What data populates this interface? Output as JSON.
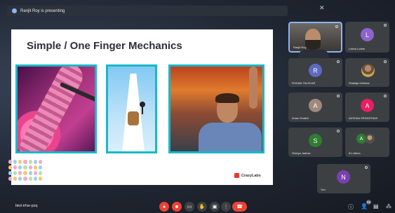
{
  "banner": {
    "text": "Ranjit Roy is presenting"
  },
  "slide": {
    "title": "Simple / One Finger Mechanics",
    "brand": "CrazyLabs"
  },
  "participants": [
    {
      "name": "Ranjit Roy",
      "type": "video"
    },
    {
      "name": "Lekha Lodhe",
      "initial": "L",
      "color": "#8e63ce"
    },
    {
      "name": "ROHAN TALEKAR",
      "initial": "R",
      "color": "#5c6bc0"
    },
    {
      "name": "Shailaja Ulhikkar",
      "type": "photo"
    },
    {
      "name": "Aman Khakhi",
      "initial": "A",
      "color": "#a1887f"
    },
    {
      "name": "AKSHAA SRIVASTAVA",
      "initial": "A",
      "color": "#e91e63"
    },
    {
      "name": "Shreya Jadhav",
      "initial": "S",
      "color": "#2e7d32"
    },
    {
      "name": "61 others",
      "initial": "A",
      "color": "#2e7d32"
    },
    {
      "name": "You",
      "initial": "N",
      "color": "#7b3fb0"
    }
  ],
  "toolbar": {
    "meeting_code": "bkd-irhw-pzq",
    "participant_count": "65"
  }
}
